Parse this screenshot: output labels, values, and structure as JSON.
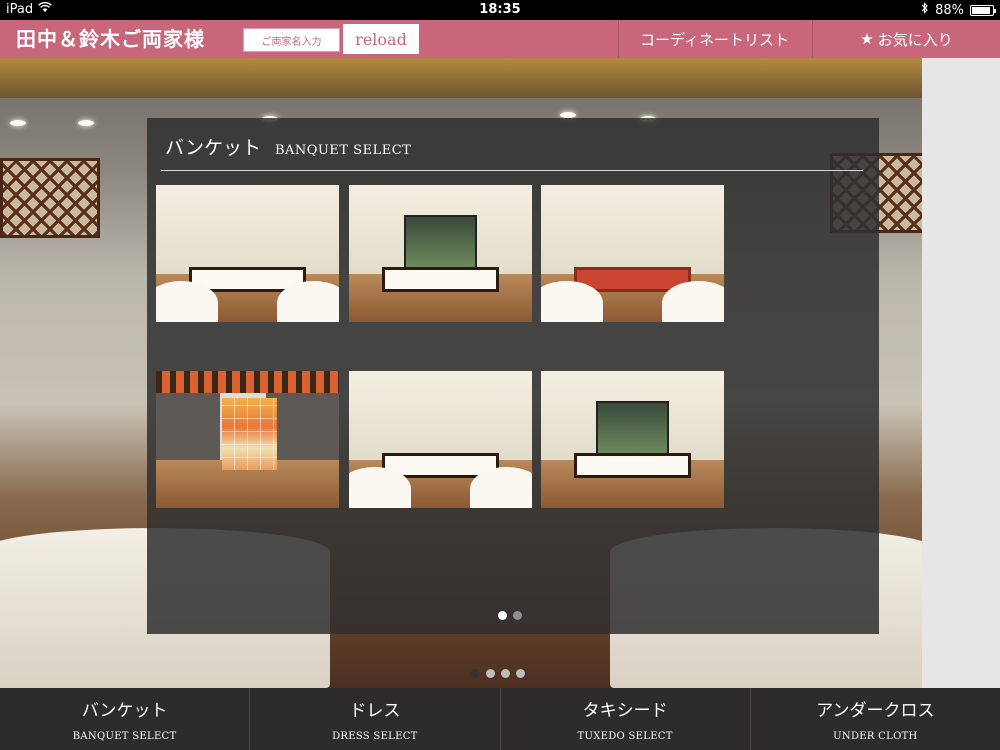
{
  "status_bar": {
    "device": "iPad",
    "time": "18:35",
    "battery": "88%",
    "battery_level": 0.88
  },
  "header": {
    "title": "田中＆鈴木ご両家様",
    "name_input_button": "ご両家名入力",
    "reload_button": "reload",
    "coordinate_list_link": "コーディネートリスト",
    "favorites_star": "★",
    "favorites_link": "お気に入り"
  },
  "panel": {
    "title_jp": "バンケット",
    "title_en": "BANQUET SELECT",
    "thumbnails": [
      {
        "kind": "hall"
      },
      {
        "kind": "window"
      },
      {
        "kind": "hall-wide"
      },
      {
        "kind": "colorwall"
      },
      {
        "kind": "hall"
      },
      {
        "kind": "window"
      }
    ],
    "page_dots": {
      "count": 2,
      "active": 0
    }
  },
  "background_pager": {
    "count": 4,
    "active": 0
  },
  "tabs": [
    {
      "label": "バンケット",
      "sub": "BANQUET SELECT"
    },
    {
      "label": "ドレス",
      "sub": "DRESS SELECT"
    },
    {
      "label": "タキシード",
      "sub": "TUXEDO SELECT"
    },
    {
      "label": "アンダークロス",
      "sub": "UNDER CLOTH"
    }
  ],
  "colors": {
    "header_pink": "#c8667c",
    "tab_bar": "#2e2b2b",
    "panel_overlay": "rgba(48,48,48,0.86)"
  }
}
